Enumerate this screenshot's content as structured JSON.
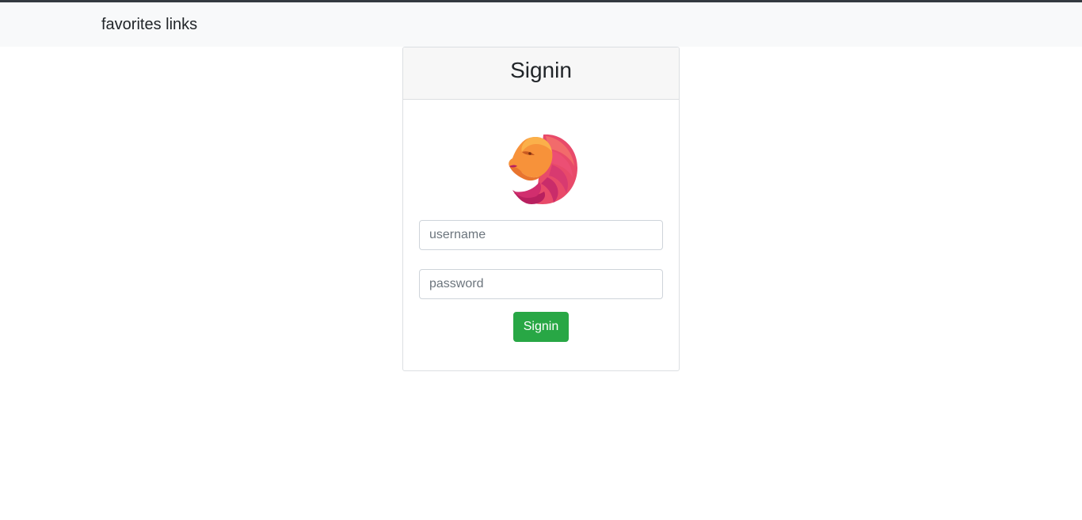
{
  "navbar": {
    "brand": "favorites links"
  },
  "signin_card": {
    "title": "Signin",
    "logo_icon": "lion-logo-icon",
    "username": {
      "placeholder": "username",
      "value": ""
    },
    "password": {
      "placeholder": "password",
      "value": ""
    },
    "submit_label": "Signin"
  },
  "colors": {
    "navbar_bg": "#f8f9fa",
    "top_border": "#343a40",
    "card_header_bg": "#f7f7f7",
    "button_green": "#28a745"
  }
}
